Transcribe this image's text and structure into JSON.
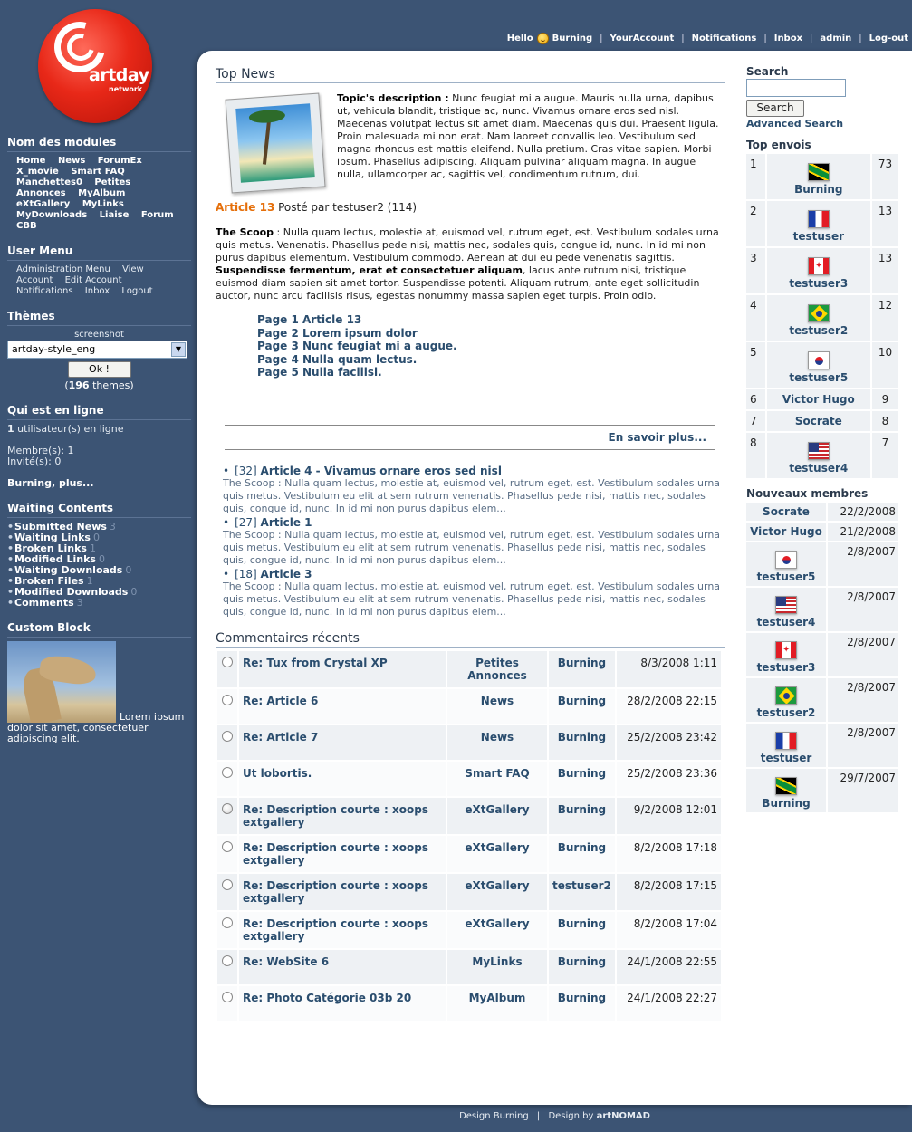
{
  "topnav": {
    "hello": "Hello",
    "user": "Burning",
    "links": [
      "YourAccount",
      "Notifications",
      "Inbox",
      "admin",
      "Log-out"
    ]
  },
  "logo": {
    "brand": "artday",
    "sub": "network"
  },
  "sidebar": {
    "modules_title": "Nom des modules",
    "modules": [
      "Home",
      "News",
      "ForumEx",
      "X_movie",
      "Smart FAQ",
      "Manchettes0",
      "Petites Annonces",
      "MyAlbum",
      "eXtGallery",
      "MyLinks",
      "MyDownloads",
      "Liaise",
      "Forum CBB"
    ],
    "usermenu_title": "User Menu",
    "usermenu": [
      "Administration Menu",
      "View Account",
      "Edit Account",
      "Notifications",
      "Inbox",
      "Logout"
    ],
    "themes_title": "Thèmes",
    "theme_label": "screenshot",
    "theme_selected": "artday-style_eng",
    "ok_label": "Ok !",
    "theme_count": "196",
    "theme_count_suffix": " themes)",
    "online_title": "Qui est en ligne",
    "online_count": "1",
    "online_text": " utilisateur(s) en ligne",
    "members_line": "Membre(s): 1",
    "guests_line": "Invité(s): 0",
    "online_more": "Burning, plus...",
    "waiting_title": "Waiting Contents",
    "waiting": [
      {
        "label": "Submitted News",
        "count": "3"
      },
      {
        "label": "Waiting Links",
        "count": "0"
      },
      {
        "label": "Broken Links",
        "count": "1"
      },
      {
        "label": "Modified Links",
        "count": "0"
      },
      {
        "label": "Waiting Downloads",
        "count": "0"
      },
      {
        "label": "Broken Files",
        "count": "1"
      },
      {
        "label": "Modified Downloads",
        "count": "0"
      },
      {
        "label": "Comments",
        "count": "3"
      }
    ],
    "custom_title": "Custom Block",
    "custom_text": "Lorem ipsum dolor sit amet, consectetuer adipiscing elit."
  },
  "main": {
    "news_title": "Top News",
    "topic_label": "Topic's description :",
    "topic_text": " Nunc feugiat mi a augue. Mauris nulla urna, dapibus ut, vehicula blandit, tristique ac, nunc. Vivamus ornare eros sed nisl. Maecenas volutpat lectus sit amet diam. Maecenas quis dui. Praesent ligula. Proin malesuada mi non erat. Nam laoreet convallis leo. Vestibulum sed magna rhoncus est mattis eleifend. Nulla pretium. Cras vitae sapien. Morbi ipsum. Phasellus adipiscing. Aliquam pulvinar aliquam magna. In augue nulla, ullamcorper ac, sagittis vel, condimentum rutrum, dui.",
    "article_link": "Article 13",
    "article_meta": " Posté par testuser2 (114)",
    "scoop_label": "The Scoop",
    "scoop_text1": " : Nulla quam lectus, molestie at, euismod vel, rutrum eget, est. Vestibulum sodales urna quis metus. Venenatis. Phasellus pede nisi, mattis nec, sodales quis, congue id, nunc. In id mi non purus dapibus elementum. Vestibulum commodo. Aenean at dui eu pede venenatis sagittis. ",
    "scoop_bold": "Suspendisse fermentum, erat et consectetuer aliquam",
    "scoop_text2": ", lacus ante rutrum nisi, tristique euismod diam sapien sit amet tortor. Suspendisse potenti. Aliquam rutrum, ante eget sollicitudin auctor, nunc arcu facilisis risus, egestas nonummy massa sapien eget turpis. Proin odio.",
    "pages": [
      "Page 1 Article 13",
      "Page 2 Lorem ipsum dolor",
      "Page 3 Nunc feugiat mi a augue.",
      "Page 4 Nulla quam lectus.",
      "Page 5 Nulla facilisi."
    ],
    "more_label": "En savoir plus...",
    "other_articles": [
      {
        "num": "[32]",
        "title": "Article 4 - Vivamus ornare eros sed nisl",
        "desc": "The Scoop : Nulla quam lectus, molestie at, euismod vel, rutrum eget, est. Vestibulum sodales urna quis metus. Vestibulum eu elit at sem rutrum venenatis. Phasellus pede nisi, mattis nec, sodales quis, congue id, nunc. In id mi non purus dapibus elem..."
      },
      {
        "num": "[27]",
        "title": "Article 1",
        "desc": "The Scoop : Nulla quam lectus, molestie at, euismod vel, rutrum eget, est. Vestibulum sodales urna quis metus. Vestibulum eu elit at sem rutrum venenatis. Phasellus pede nisi, mattis nec, sodales quis, congue id, nunc. In id mi non purus dapibus elem..."
      },
      {
        "num": "[18]",
        "title": "Article 3",
        "desc": "The Scoop : Nulla quam lectus, molestie at, euismod vel, rutrum eget, est. Vestibulum sodales urna quis metus. Vestibulum eu elit at sem rutrum venenatis. Phasellus pede nisi, mattis nec, sodales quis, congue id, nunc. In id mi non purus dapibus elem..."
      }
    ],
    "comments_title": "Commentaires récents",
    "comments": [
      {
        "title": "Re: Tux from Crystal XP",
        "module": "Petites Annonces",
        "user": "Burning",
        "date": "8/3/2008 1:11",
        "icon": "circle"
      },
      {
        "title": "Re: Article 6",
        "module": "News",
        "user": "Burning",
        "date": "28/2/2008 22:15",
        "icon": "circle"
      },
      {
        "title": "Re: Article 7",
        "module": "News",
        "user": "Burning",
        "date": "25/2/2008 23:42",
        "icon": "circle"
      },
      {
        "title": "Ut lobortis.",
        "module": "Smart FAQ",
        "user": "Burning",
        "date": "25/2/2008 23:36",
        "icon": "circle"
      },
      {
        "title": "Re: Description courte : xoops extgallery",
        "module": "eXtGallery",
        "user": "Burning",
        "date": "9/2/2008 12:01",
        "icon": "smiley"
      },
      {
        "title": "Re: Description courte : xoops extgallery",
        "module": "eXtGallery",
        "user": "Burning",
        "date": "8/2/2008 17:18",
        "icon": "circle"
      },
      {
        "title": "Re: Description courte : xoops extgallery",
        "module": "eXtGallery",
        "user": "testuser2",
        "date": "8/2/2008 17:15",
        "icon": "circle"
      },
      {
        "title": "Re: Description courte : xoops extgallery",
        "module": "eXtGallery",
        "user": "Burning",
        "date": "8/2/2008 17:04",
        "icon": "circle"
      },
      {
        "title": "Re: WebSite 6",
        "module": "MyLinks",
        "user": "Burning",
        "date": "24/1/2008 22:55",
        "icon": "circle"
      },
      {
        "title": "Re: Photo Catégorie 03b 20",
        "module": "MyAlbum",
        "user": "Burning",
        "date": "24/1/2008 22:27",
        "icon": "circle"
      }
    ]
  },
  "right": {
    "search_title": "Search",
    "search_button": "Search",
    "advanced_search": "Advanced Search",
    "top_title": "Top envois",
    "top": [
      {
        "rank": "1",
        "user": "Burning",
        "count": "73",
        "flag": "jm"
      },
      {
        "rank": "2",
        "user": "testuser",
        "count": "13",
        "flag": "fr"
      },
      {
        "rank": "3",
        "user": "testuser3",
        "count": "13",
        "flag": "ca"
      },
      {
        "rank": "4",
        "user": "testuser2",
        "count": "12",
        "flag": "br"
      },
      {
        "rank": "5",
        "user": "testuser5",
        "count": "10",
        "flag": "kr"
      },
      {
        "rank": "6",
        "user": "Victor Hugo",
        "count": "9",
        "flag": ""
      },
      {
        "rank": "7",
        "user": "Socrate",
        "count": "8",
        "flag": ""
      },
      {
        "rank": "8",
        "user": "testuser4",
        "count": "7",
        "flag": "us"
      }
    ],
    "new_title": "Nouveaux membres",
    "new_members": [
      {
        "user": "Socrate",
        "date": "22/2/2008",
        "flag": ""
      },
      {
        "user": "Victor Hugo",
        "date": "21/2/2008",
        "flag": ""
      },
      {
        "user": "testuser5",
        "date": "2/8/2007",
        "flag": "kr"
      },
      {
        "user": "testuser4",
        "date": "2/8/2007",
        "flag": "us"
      },
      {
        "user": "testuser3",
        "date": "2/8/2007",
        "flag": "ca"
      },
      {
        "user": "testuser2",
        "date": "2/8/2007",
        "flag": "br"
      },
      {
        "user": "testuser",
        "date": "2/8/2007",
        "flag": "fr"
      },
      {
        "user": "Burning",
        "date": "29/7/2007",
        "flag": "jm"
      }
    ]
  },
  "footer": {
    "left": "Design Burning",
    "right_prefix": "Design by ",
    "right_brand": "artNOMAD"
  }
}
